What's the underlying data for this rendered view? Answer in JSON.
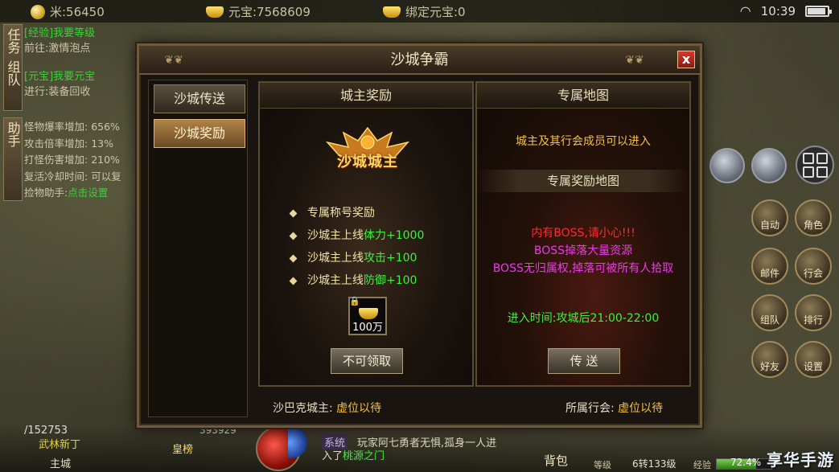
{
  "status_bar": {
    "coins": "米:56450",
    "yuanbao": "元宝:7568609",
    "bound_yuanbao": "绑定元宝:0",
    "time": "10:39"
  },
  "quest_panel": {
    "tab_quest": "任务",
    "tab_team": "组队",
    "q1_title": "[经验]我要等级",
    "q1_sub": "前往:激情泡点",
    "q2_title": "[元宝]我要元宝",
    "q2_sub": "进行:装备回收"
  },
  "helper_panel": {
    "tab": "助手",
    "lines": [
      {
        "label": "怪物爆率增加:",
        "value": "656%"
      },
      {
        "label": "攻击倍率增加:",
        "value": "13%"
      },
      {
        "label": "打怪伤害增加:",
        "value": "210%"
      },
      {
        "label": "复活冷却时间:",
        "value": "可以复"
      }
    ],
    "pickup_label": "捡物助手:",
    "pickup_link": "点击设置"
  },
  "right_icons": [
    "自动",
    "角色",
    "邮件",
    "行会",
    "组队",
    "排行",
    "好友",
    "设置"
  ],
  "bottom_hud": {
    "exp_value": "/152753",
    "hp_value": "393929",
    "char_name": "武林新丁",
    "map": "主城",
    "title_badge": "皇榜",
    "chat_tag": "系统",
    "chat_line1": "玩家阿七勇者无惧,孤身一人进",
    "chat_line2": "入了",
    "chat_link": "桃源之门",
    "bag": "背包",
    "level_label": "等级",
    "level_value": "6转133级",
    "exp_label": "经验",
    "exp_percent": "72.4%"
  },
  "dialog": {
    "title": "沙城争霸",
    "close": "x",
    "nav": [
      "沙城传送",
      "沙城奖励"
    ],
    "left_panel": {
      "header": "城主奖励",
      "crest_text": "沙城城主",
      "rewards": [
        {
          "prefix": "专属称号奖励",
          "highlight": ""
        },
        {
          "prefix": "沙城主上线",
          "highlight": "体力+1000"
        },
        {
          "prefix": "沙城主上线",
          "highlight": "攻击+100"
        },
        {
          "prefix": "沙城主上线",
          "highlight": "防御+100"
        }
      ],
      "item_qty": "100万",
      "claim_button": "不可领取"
    },
    "right_panel": {
      "header": "专属地图",
      "access_text": "城主及其行会成员可以进入",
      "sub_header": "专属奖励地图",
      "warn1": "内有BOSS,请小心!!!",
      "warn2": "BOSS掉落大量资源",
      "warn3": "BOSS无归属权,掉落可被所有人拾取",
      "entry_time": "进入时间:攻城后21:00-22:00",
      "teleport_button": "传 送"
    },
    "footer": {
      "lord_label": "沙巴克城主:",
      "lord_value": "虚位以待",
      "guild_label": "所属行会:",
      "guild_value": "虚位以待"
    }
  },
  "watermark": "享华手游",
  "colors": {
    "accent_gold": "#f5c23a",
    "green": "#3df03d",
    "red": "#ff2a2a",
    "magenta": "#e83ae8"
  }
}
